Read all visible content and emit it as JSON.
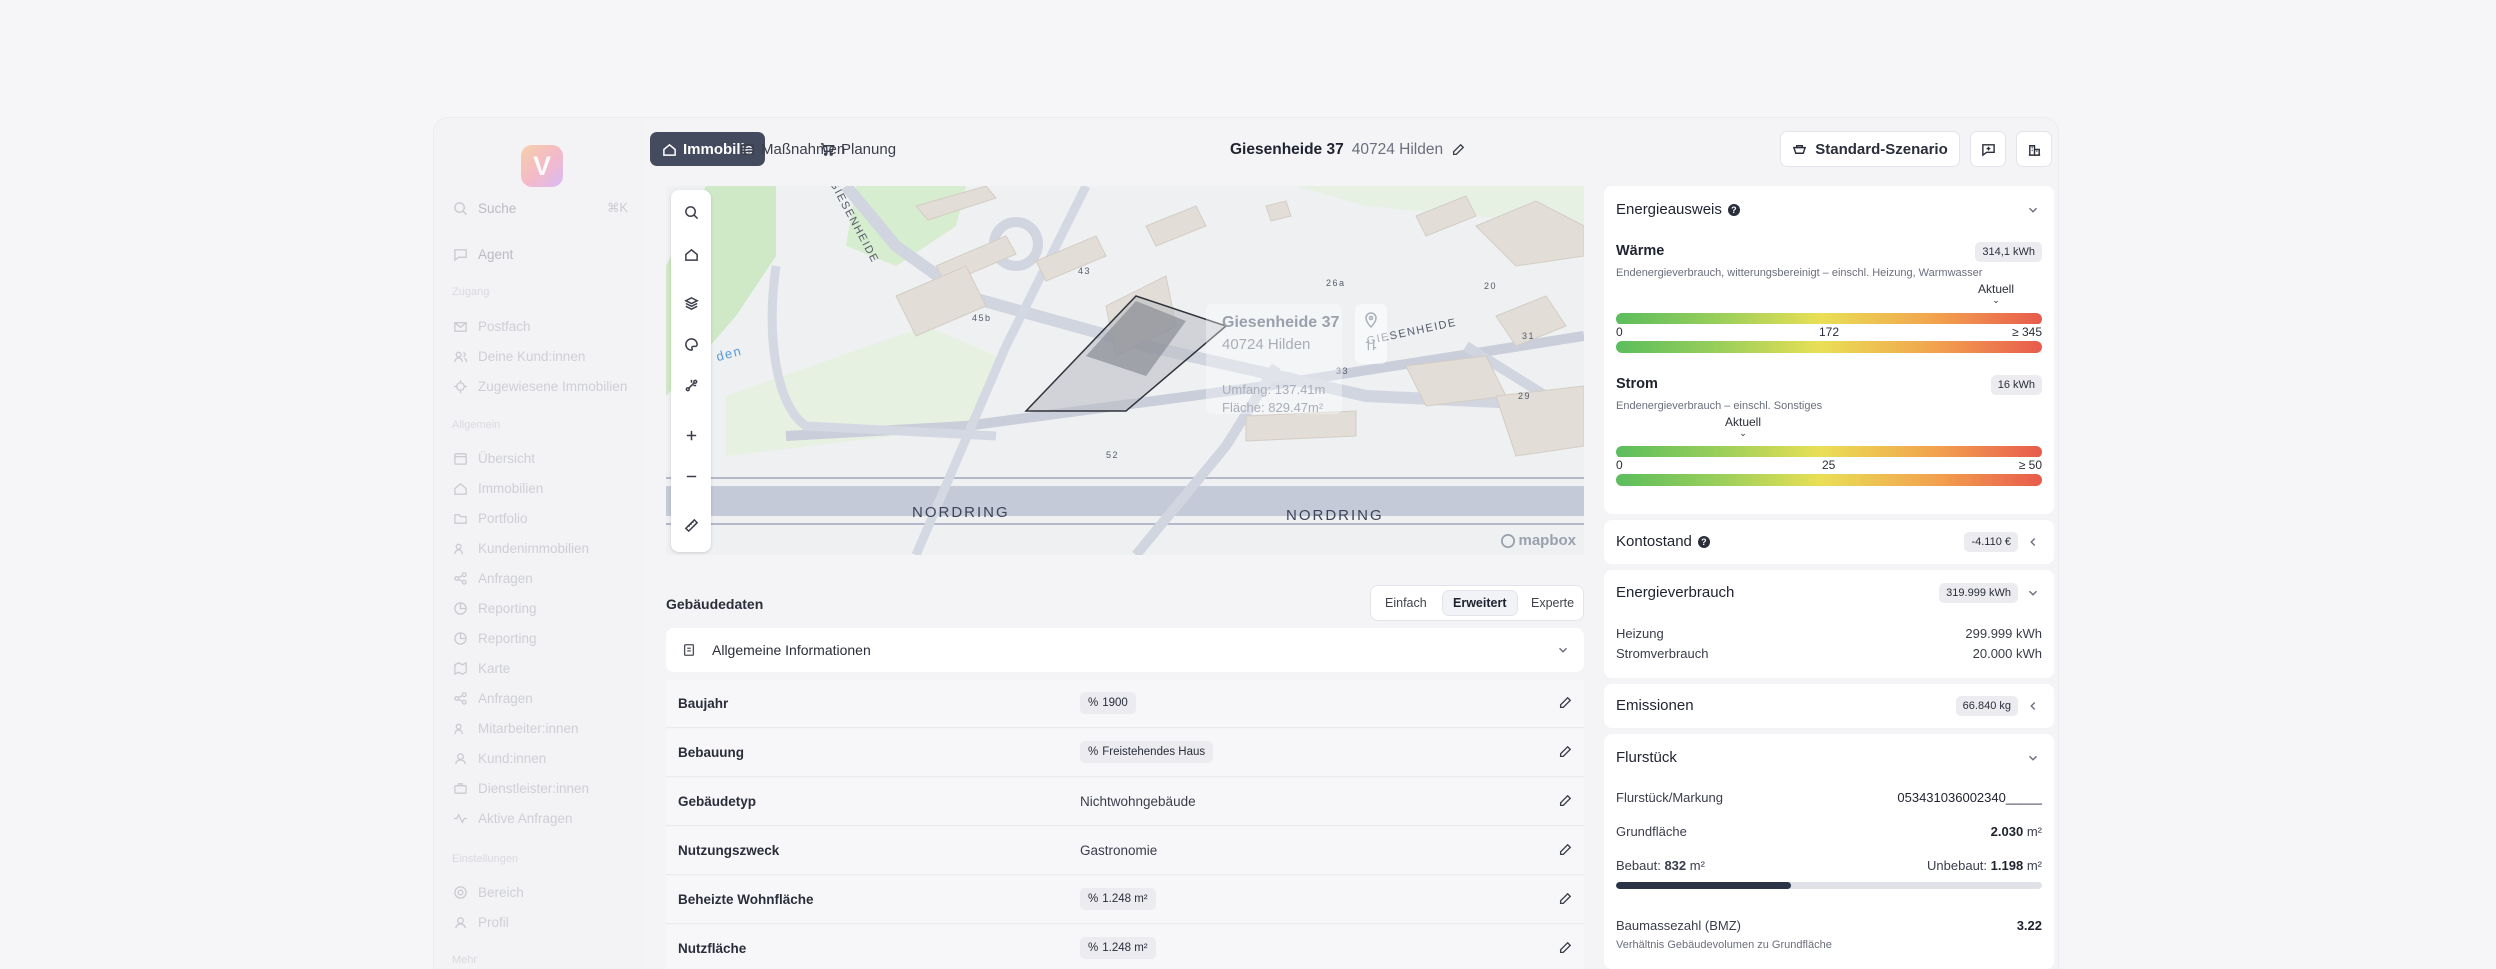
{
  "sidebar": {
    "logo": "V",
    "search": {
      "label": "Suche",
      "shortcut": "⌘K"
    },
    "agent": "Agent",
    "section1": "Zugang",
    "group1": [
      "Postfach",
      "Deine Kund:innen",
      "Zugewiesene Immobilien"
    ],
    "section2": "Allgemein",
    "group2": [
      "Übersicht",
      "Immobilien",
      "Portfolio",
      "Kundenimmobilien",
      "Anfragen",
      "Reporting",
      "Reporting",
      "Karte",
      "Anfragen",
      "Mitarbeiter:innen",
      "Kund:innen",
      "Dienstleister:innen",
      "Aktive Anfragen"
    ],
    "section3": "Einstellungen",
    "group3": [
      "Bereich",
      "Profil"
    ],
    "section4": "Mehr"
  },
  "topbar": {
    "tabs": [
      {
        "label": "Immobilie",
        "icon": "home-icon",
        "active": true
      },
      {
        "label": "Maßnahmen",
        "icon": "list-icon",
        "active": false
      },
      {
        "label": "Planung",
        "icon": "cart-icon",
        "active": false
      }
    ],
    "address": {
      "street": "Giesenheide 37",
      "city": "40724 Hilden"
    },
    "scenario": "Standard-Szenario"
  },
  "map": {
    "streets": [
      "NORDRING",
      "NORDRING",
      "GIESENHEIDE",
      "GIESENHEIDE"
    ],
    "numbers": [
      "43",
      "45b",
      "26a",
      "20",
      "31",
      "29",
      "33",
      "52"
    ],
    "water_label": "den",
    "popup": {
      "title": "Giesenheide 37",
      "city": "40724 Hilden",
      "umfang_label": "Umfang:",
      "umfang": "137.41m",
      "flaeche_label": "Fläche:",
      "flaeche": "829.47m²"
    },
    "attribution": "mapbox"
  },
  "gebaeudedaten": {
    "title": "Gebäudedaten",
    "modes": [
      "Einfach",
      "Erweitert",
      "Experte"
    ],
    "active_mode": "Erweitert",
    "accordion": "Allgemeine Informationen",
    "rows": [
      {
        "label": "Baujahr",
        "value": "1900",
        "pill": true
      },
      {
        "label": "Bebauung",
        "value": "Freistehendes Haus",
        "pill": true
      },
      {
        "label": "Gebäudetyp",
        "value": "Nichtwohngebäude",
        "pill": false
      },
      {
        "label": "Nutzungszweck",
        "value": "Gastronomie",
        "pill": false
      },
      {
        "label": "Beheizte Wohnfläche",
        "value": "1.248 m²",
        "pill": true
      },
      {
        "label": "Nutzfläche",
        "value": "1.248 m²",
        "pill": true
      }
    ]
  },
  "energieausweis": {
    "title": "Energieausweis",
    "waerme": {
      "title": "Wärme",
      "badge": "314,1 kWh",
      "desc": "Endenergieverbrauch, witterungsbereinigt – einschl. Heizung, Warmwasser",
      "marker": "Aktuell",
      "marker_value": 314.1,
      "scale": [
        "0",
        "172",
        "≥ 345"
      ],
      "scale_max": 345
    },
    "strom": {
      "title": "Strom",
      "badge": "16 kWh",
      "desc": "Endenergieverbrauch – einschl. Sonstiges",
      "marker": "Aktuell",
      "marker_value": 16,
      "scale": [
        "0",
        "25",
        "≥ 50"
      ],
      "scale_max": 50
    }
  },
  "kontostand": {
    "title": "Kontostand",
    "badge": "-4.110 €"
  },
  "energieverbrauch": {
    "title": "Energieverbrauch",
    "badge": "319.999 kWh",
    "items": [
      {
        "label": "Heizung",
        "value": "299.999 kWh"
      },
      {
        "label": "Stromverbrauch",
        "value": "20.000 kWh"
      }
    ]
  },
  "emissionen": {
    "title": "Emissionen",
    "badge": "66.840 kg"
  },
  "flurstueck": {
    "title": "Flurstück",
    "markung_label": "Flurstück/Markung",
    "markung_value": "053431036002340_____",
    "grund_label": "Grundfläche",
    "grund_value": "2.030",
    "unit": "m²",
    "bebaut_label": "Bebaut:",
    "bebaut_value": "832",
    "unbebaut_label": "Unbebaut:",
    "unbebaut_value": "1.198",
    "bebaut_fraction": 0.41,
    "bmz_label": "Baumassezahl (BMZ)",
    "bmz_value": "3.22",
    "bmz_desc": "Verhältnis Gebäudevolumen zu Grundfläche"
  }
}
